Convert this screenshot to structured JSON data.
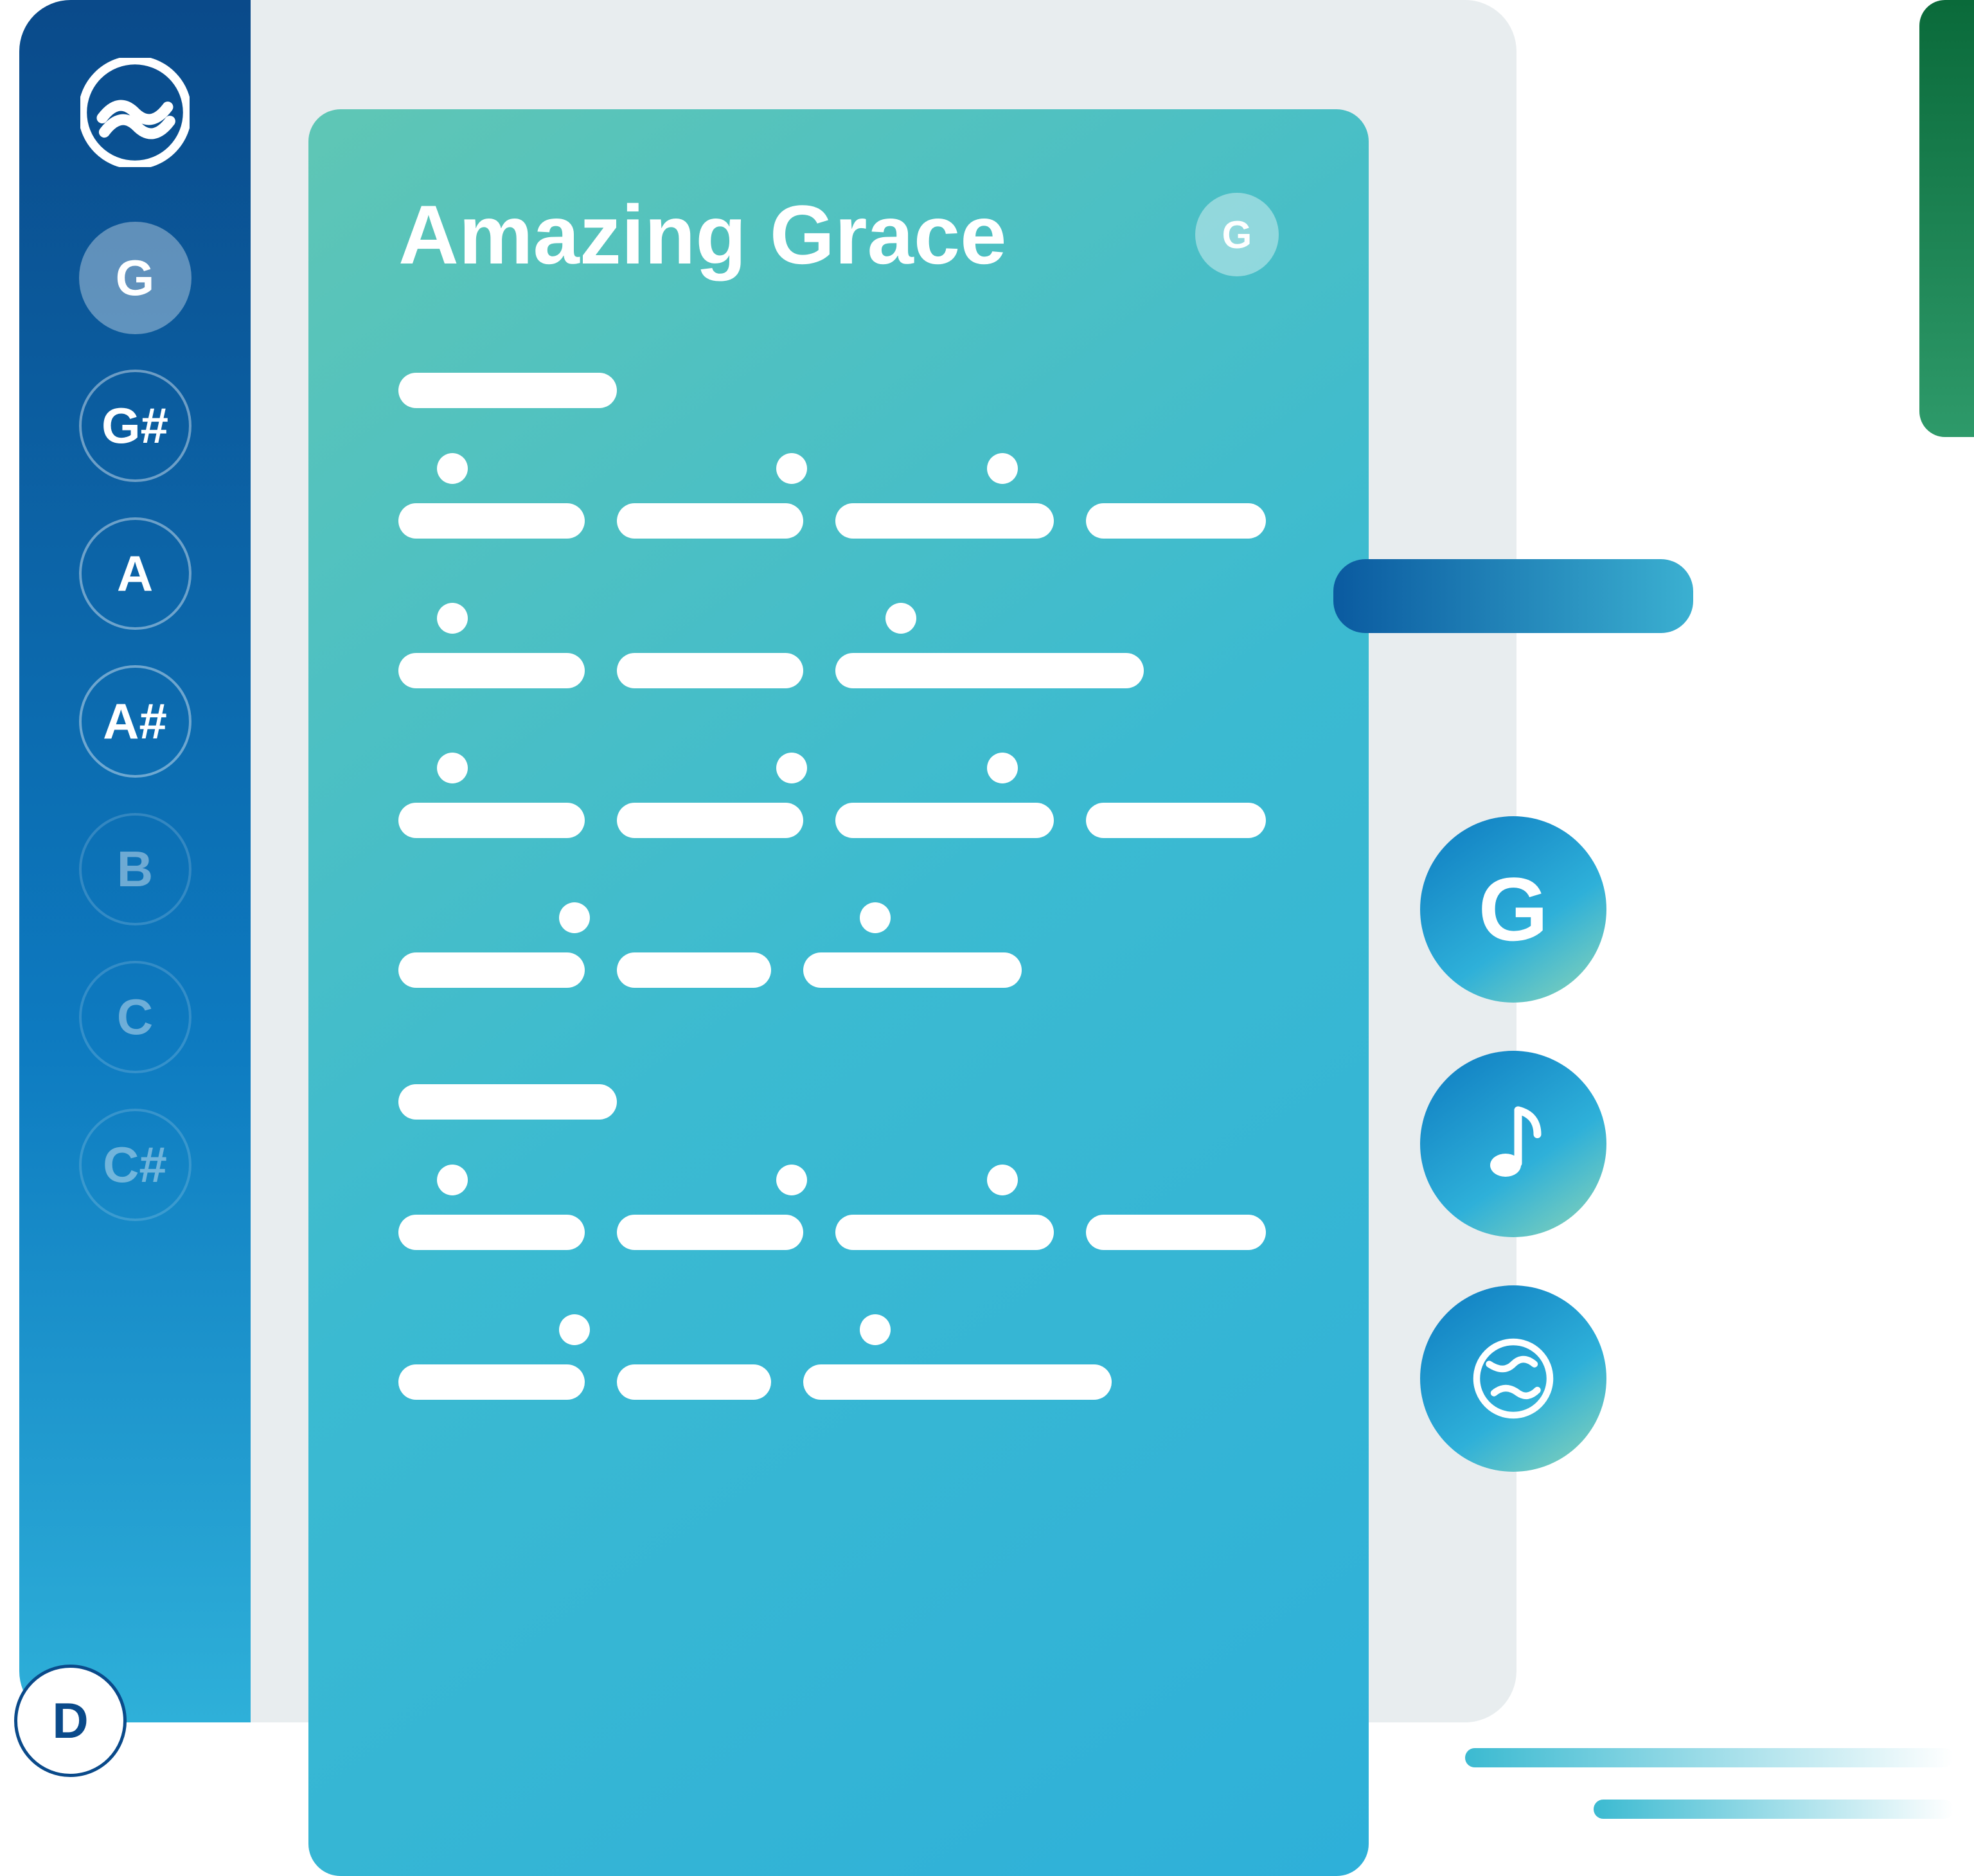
{
  "sidebar": {
    "keys": [
      {
        "label": "G",
        "selected": true,
        "faded": false
      },
      {
        "label": "G#",
        "selected": false,
        "faded": false
      },
      {
        "label": "A",
        "selected": false,
        "faded": false
      },
      {
        "label": "A#",
        "selected": false,
        "faded": false
      },
      {
        "label": "B",
        "selected": false,
        "faded": true
      },
      {
        "label": "C",
        "selected": false,
        "faded": true
      },
      {
        "label": "C#",
        "selected": false,
        "faded": true
      }
    ],
    "overflow_key": "D"
  },
  "sheet": {
    "title": "Amazing Grace",
    "key_badge": "G"
  },
  "side_buttons": {
    "key": "G",
    "icons": [
      "music-note-icon",
      "globe-icon"
    ]
  }
}
